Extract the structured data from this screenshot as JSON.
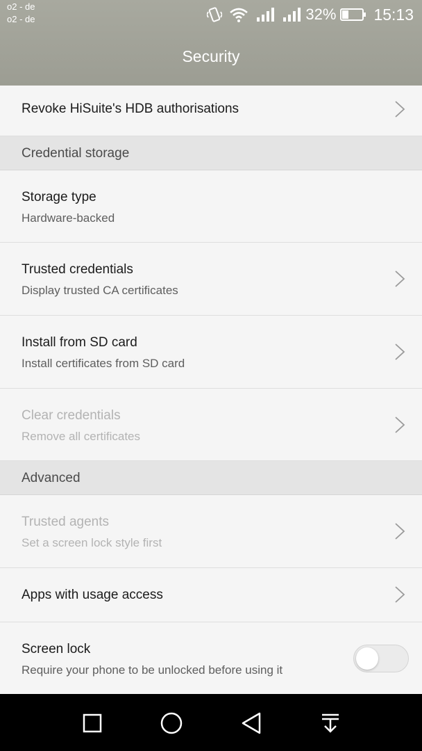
{
  "status_bar": {
    "carrier_1": "o2 - de",
    "carrier_2": "o2 - de",
    "battery_percent": "32%",
    "battery_level": 0.32,
    "time": "15:13",
    "icons": [
      "vibrate-icon",
      "wifi-icon",
      "signal-icon",
      "signal-icon",
      "battery-icon"
    ]
  },
  "header": {
    "title": "Security",
    "color": "#a0a197"
  },
  "items": {
    "revoke": {
      "title": "Revoke HiSuite's HDB authorisations"
    },
    "credential_section": "Credential storage",
    "storage_type": {
      "title": "Storage type",
      "sub": "Hardware-backed"
    },
    "trusted_credentials": {
      "title": "Trusted credentials",
      "sub": "Display trusted CA certificates"
    },
    "install_sd": {
      "title": "Install from SD card",
      "sub": "Install certificates from SD card"
    },
    "clear_credentials": {
      "title": "Clear credentials",
      "sub": "Remove all certificates",
      "enabled": false
    },
    "advanced_section": "Advanced",
    "trusted_agents": {
      "title": "Trusted agents",
      "sub": "Set a screen lock style first",
      "enabled": false
    },
    "usage_access": {
      "title": "Apps with usage access"
    },
    "screen_lock": {
      "title": "Screen lock",
      "sub": "Require your phone to be unlocked before using it",
      "toggle_on": false
    }
  },
  "nav_bar": {
    "buttons": [
      "recents-square-icon",
      "home-circle-icon",
      "back-triangle-icon",
      "notification-pull-icon"
    ]
  }
}
